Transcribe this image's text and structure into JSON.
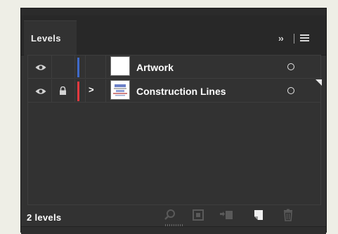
{
  "panel": {
    "tab_label": "Levels",
    "overflow_label": "››",
    "menu_icon": "hamburger-menu-icon"
  },
  "layers": [
    {
      "name": "Artwork",
      "visible": true,
      "locked": false,
      "expandable": false,
      "color": "#3f6ac9",
      "thumbnail": "blank"
    },
    {
      "name": "Construction Lines",
      "visible": true,
      "locked": true,
      "expandable": true,
      "expand_glyph": ">",
      "color": "#e2393f",
      "thumbnail": "drawing",
      "selected_indicator": true
    }
  ],
  "footer": {
    "count_label": "2 levels",
    "icons": [
      "search-icon",
      "clipping-mask-icon",
      "move-selection-icon",
      "new-layer-icon",
      "delete-icon"
    ]
  },
  "colors": {
    "panel_bg": "#323232",
    "tab_bar_bg": "#282828",
    "text": "#ffffff",
    "disabled_icon": "#5a5a5a"
  }
}
